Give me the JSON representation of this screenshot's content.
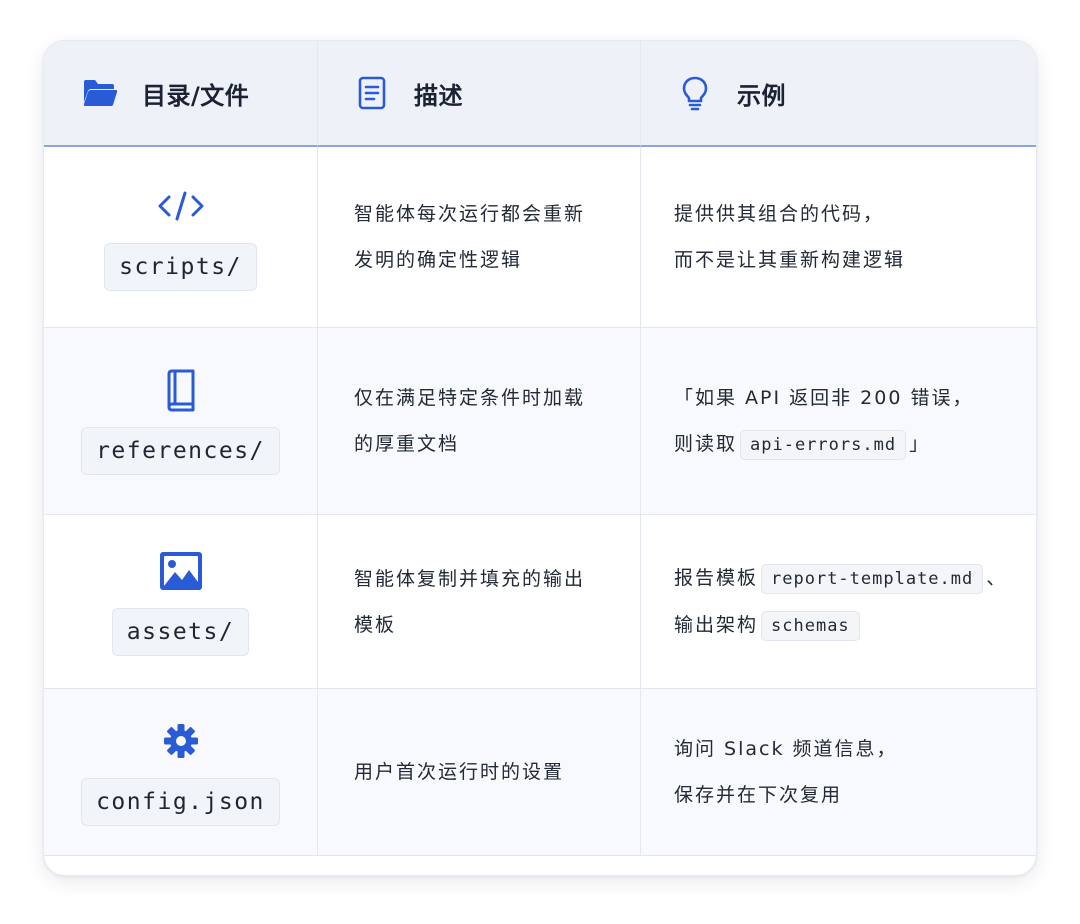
{
  "colors": {
    "accent": "#2a5bd7",
    "header_bg": "#eef2f8",
    "header_rule": "#8aa4dc",
    "text": "#222a37"
  },
  "header": {
    "col1": {
      "icon": "folder-open-icon",
      "label": "目录/文件"
    },
    "col2": {
      "icon": "document-icon",
      "label": "描述"
    },
    "col3": {
      "icon": "lightbulb-icon",
      "label": "示例"
    }
  },
  "rows": [
    {
      "icon": "code-icon",
      "name": "scripts/",
      "description": [
        "智能体每次运行都会重新",
        "发明的确定性逻辑"
      ],
      "example": {
        "line1": "提供供其组合的代码，",
        "line2": "而不是让其重新构建逻辑"
      }
    },
    {
      "icon": "book-icon",
      "name": "references/",
      "description": [
        "仅在满足特定条件时加载",
        "的厚重文档"
      ],
      "example": {
        "line1": "「如果 API 返回非 200 错误，",
        "line2_prefix": "则读取",
        "line2_code": "api-errors.md",
        "line2_suffix": "」"
      }
    },
    {
      "icon": "image-icon",
      "name": "assets/",
      "description": [
        "智能体复制并填充的输出",
        "模板"
      ],
      "example": {
        "line1_prefix": "报告模板",
        "line1_code": "report-template.md",
        "line1_suffix": "、",
        "line2_prefix": "输出架构",
        "line2_code": "schemas"
      }
    },
    {
      "icon": "gear-icon",
      "name": "config.json",
      "description": [
        "用户首次运行时的设置"
      ],
      "example": {
        "line1": "询问 Slack 频道信息，",
        "line2": "保存并在下次复用"
      }
    }
  ]
}
